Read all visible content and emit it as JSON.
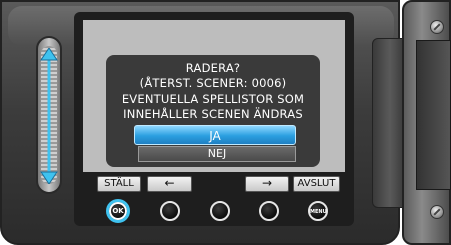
{
  "dialog": {
    "title": "RADERA?",
    "scenes_remaining": "(ÅTERST. SCENER: 0006)",
    "warning_line1": "EVENTUELLA SPELLISTOR SOM",
    "warning_line2": "INNEHÅLLER SCENEN ÄNDRAS",
    "yes_label": "JA",
    "no_label": "NEJ"
  },
  "softkeys": {
    "set_label": "STÄLL",
    "left_arrow": "←",
    "right_arrow": "→",
    "exit_label": "AVSLUT"
  },
  "buttons": {
    "ok_label": "OK",
    "menu_label": "MENU"
  },
  "colors": {
    "highlight": "#3fc2ef",
    "selected_button": "#2a9fe0",
    "dialog_bg": "#3a3a3a",
    "screen_bg": "#bdbdbd"
  },
  "icons": {
    "slider": "vertical-double-arrow-icon",
    "ok": "ok-button-icon",
    "menu": "menu-button-icon"
  }
}
